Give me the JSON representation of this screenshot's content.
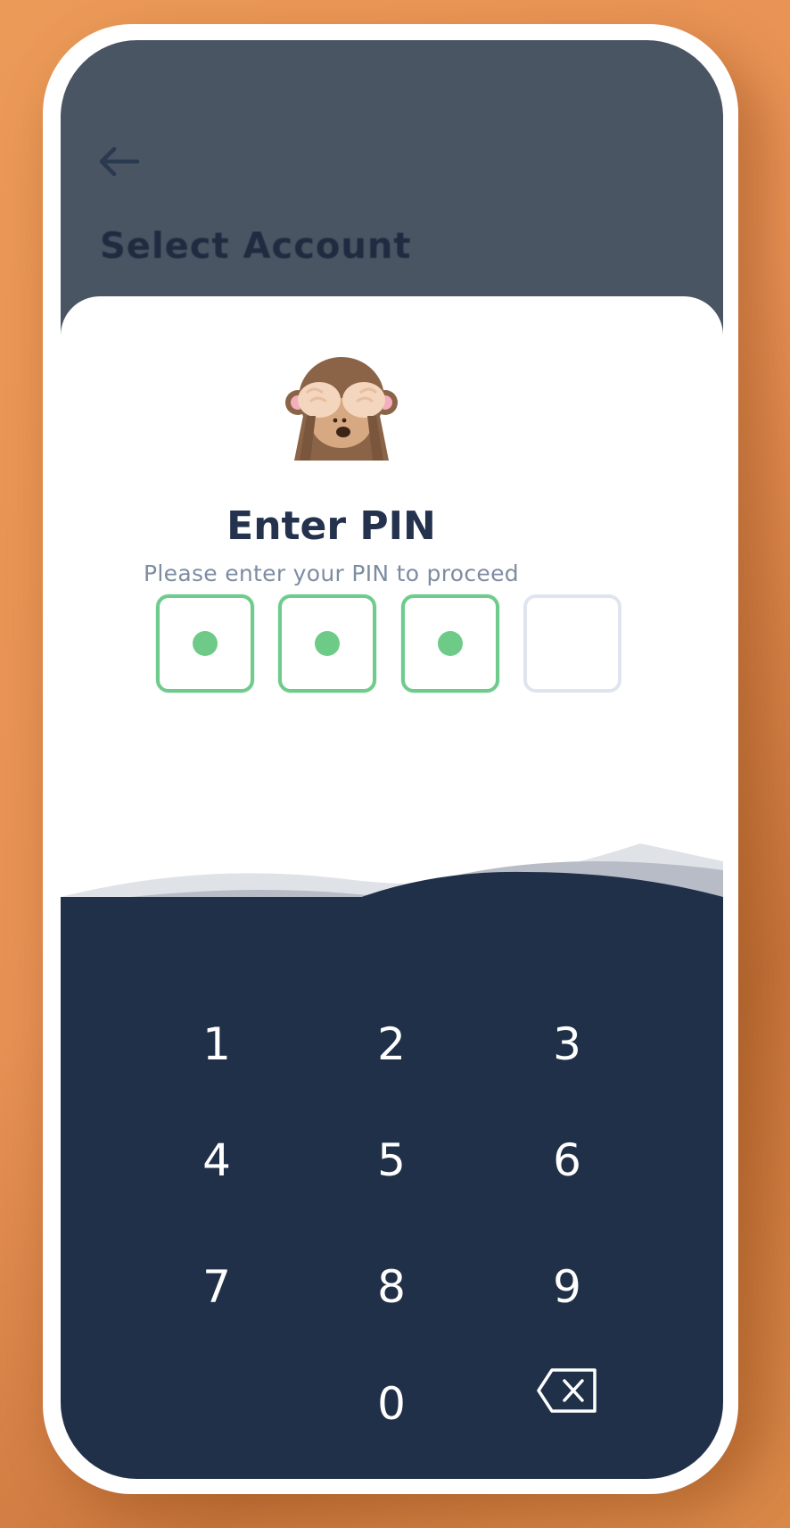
{
  "header": {
    "back_icon": "arrow-left-icon",
    "title": "Select Account"
  },
  "pin_sheet": {
    "illustration": "see-no-evil-monkey-icon",
    "title": "Enter PIN",
    "subtitle": "Please enter your PIN to proceed",
    "pin_length": 4,
    "digits_entered": 3,
    "colors": {
      "accent_green": "#6ecb87",
      "empty_border": "#dfe5ee",
      "title": "#24324d",
      "subtitle": "#7e8ca2",
      "keypad_bg": "#203049",
      "header_bg": "#4a5563"
    }
  },
  "keypad": {
    "keys": [
      "1",
      "2",
      "3",
      "4",
      "5",
      "6",
      "7",
      "8",
      "9",
      "0"
    ],
    "backspace_icon": "backspace-icon"
  }
}
